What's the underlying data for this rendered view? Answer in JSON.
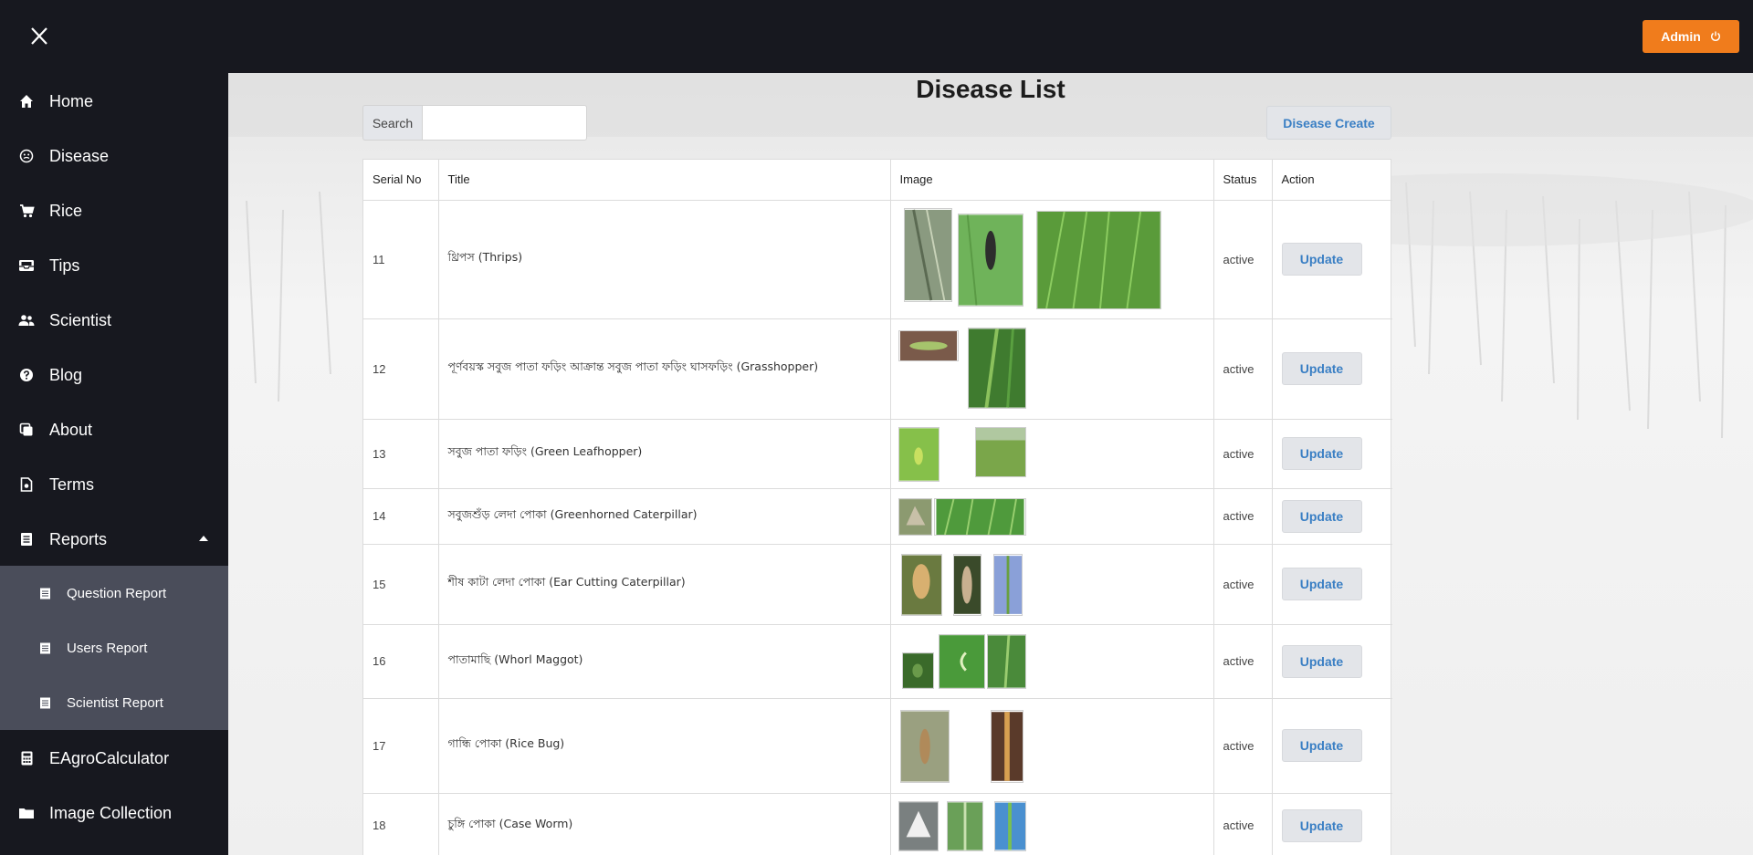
{
  "topbar": {
    "admin_label": "Admin"
  },
  "sidebar": {
    "items": [
      {
        "label": "Home",
        "icon": "home-icon"
      },
      {
        "label": "Disease",
        "icon": "smiley-icon"
      },
      {
        "label": "Rice",
        "icon": "cart-icon"
      },
      {
        "label": "Tips",
        "icon": "inbox-icon"
      },
      {
        "label": "Scientist",
        "icon": "users-icon"
      },
      {
        "label": "Blog",
        "icon": "question-icon"
      },
      {
        "label": "About",
        "icon": "copy-icon"
      },
      {
        "label": "Terms",
        "icon": "document-icon"
      },
      {
        "label": "Reports",
        "icon": "report-icon"
      }
    ],
    "reports_submenu": [
      {
        "label": "Question Report"
      },
      {
        "label": "Users Report"
      },
      {
        "label": "Scientist Report"
      }
    ],
    "bottom_items": [
      {
        "label": "EAgroCalculator",
        "icon": "calculator-icon"
      },
      {
        "label": "Image Collection",
        "icon": "folder-icon"
      }
    ]
  },
  "main": {
    "title": "Disease List",
    "search_label": "Search",
    "search_value": "",
    "create_label": "Disease Create",
    "table": {
      "headers": [
        "Serial No",
        "Title",
        "Image",
        "Status",
        "Action"
      ],
      "action_label": "Update",
      "rows": [
        {
          "serial": "11",
          "title": "থ্রিপস (Thrips)",
          "status": "active"
        },
        {
          "serial": "12",
          "title": "পূর্ণবয়স্ক সবুজ পাতা ফড়িং আক্রান্ত সবুজ পাতা ফড়িং ঘাসফড়িং (Grasshopper)",
          "status": "active"
        },
        {
          "serial": "13",
          "title": "সবুজ পাতা ফড়িং (Green Leafhopper)",
          "status": "active"
        },
        {
          "serial": "14",
          "title": "সবুজশুঁড় লেদা পোকা (Greenhorned Caterpillar)",
          "status": "active"
        },
        {
          "serial": "15",
          "title": "শীষ কাটা লেদা পোকা (Ear Cutting Caterpillar)",
          "status": "active"
        },
        {
          "serial": "16",
          "title": "পাতামাছি (Whorl Maggot)",
          "status": "active"
        },
        {
          "serial": "17",
          "title": "গান্ধি পোকা (Rice Bug)",
          "status": "active"
        },
        {
          "serial": "18",
          "title": "চুঙ্গি পোকা (Case Worm)",
          "status": "active"
        }
      ]
    }
  },
  "colors": {
    "sidebar_bg": "#17181f",
    "submenu_bg": "#4a4d5a",
    "admin_button": "#f07c1c",
    "link_blue": "#3a7fc4"
  }
}
